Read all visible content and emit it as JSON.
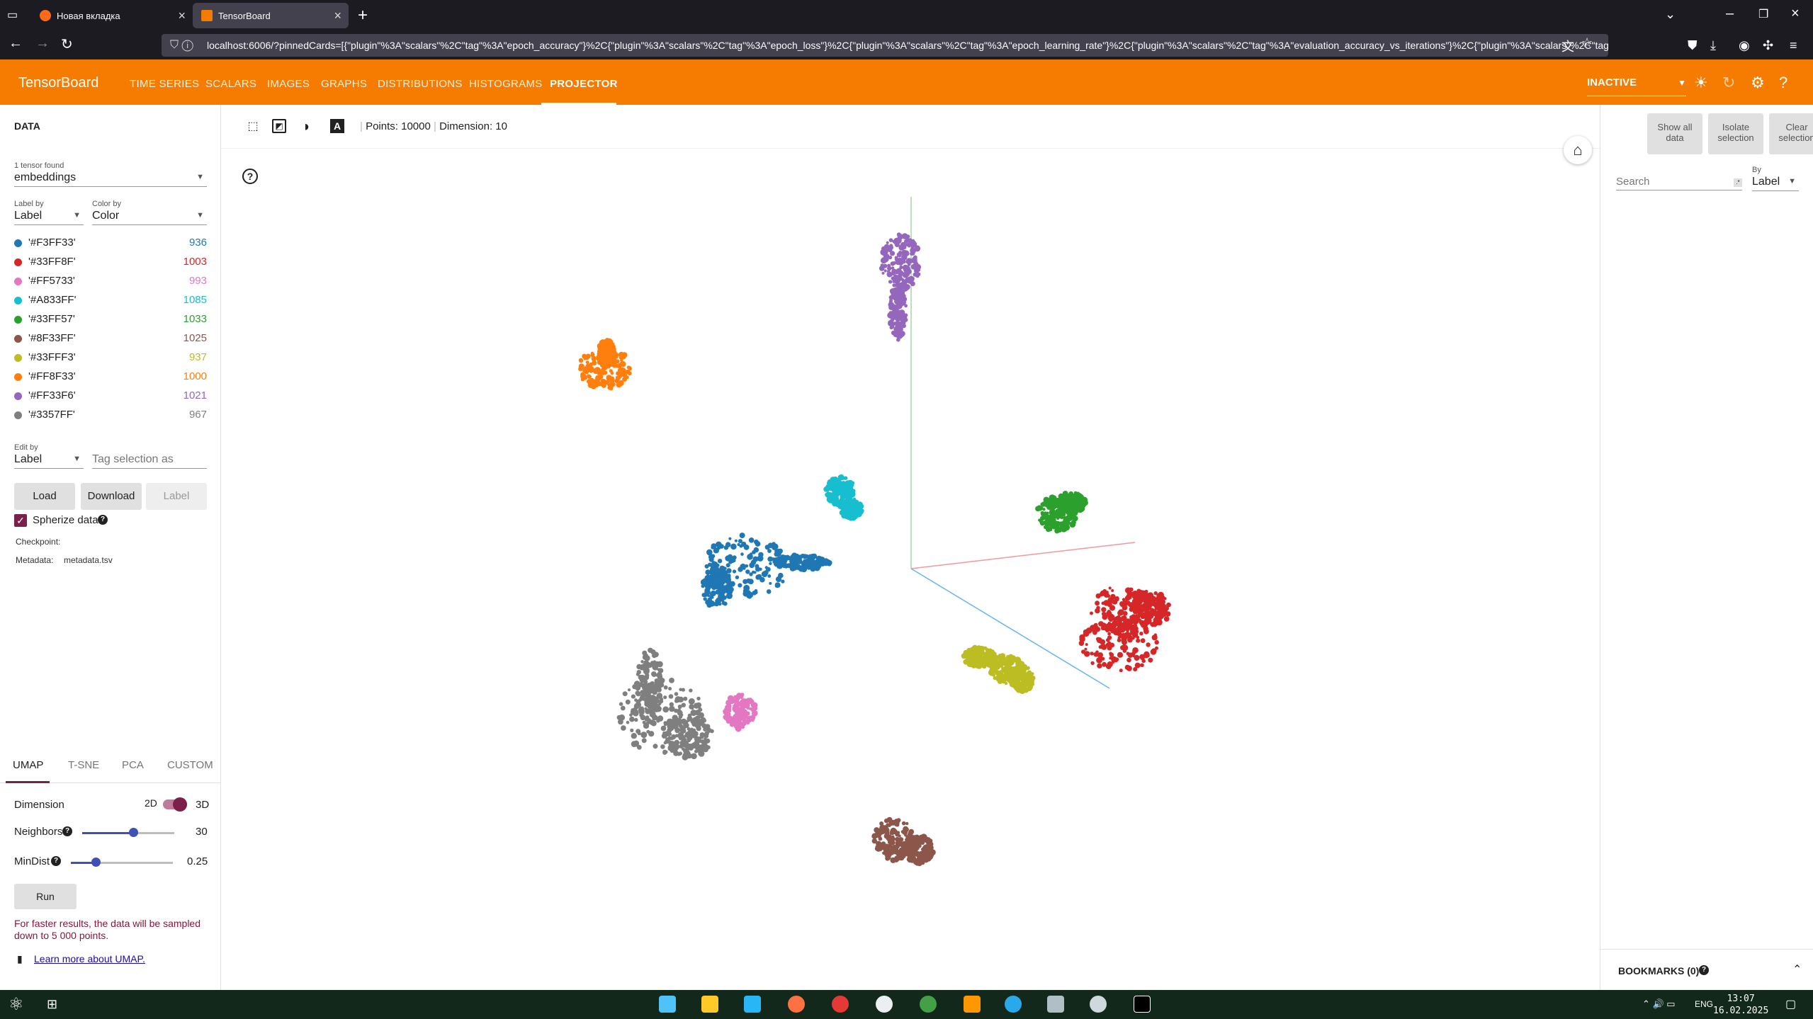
{
  "browser": {
    "tabs": [
      {
        "title": "Новая вкладка"
      },
      {
        "title": "TensorBoard"
      }
    ],
    "url": "localhost:6006/?pinnedCards=[{\"plugin\"%3A\"scalars\"%2C\"tag\"%3A\"epoch_accuracy\"}%2C{\"plugin\"%3A\"scalars\"%2C\"tag\"%3A\"epoch_loss\"}%2C{\"plugin\"%3A\"scalars\"%2C\"tag\"%3A\"epoch_learning_rate\"}%2C{\"plugin\"%3A\"scalars\"%2C\"tag\"%3A\"evaluation_accuracy_vs_iterations\"}%2C{\"plugin\"%3A\"scalars\"%2C\"tag\"%3A\"tag"
  },
  "header": {
    "logo": "TensorBoard",
    "nav": [
      "TIME SERIES",
      "SCALARS",
      "IMAGES",
      "GRAPHS",
      "DISTRIBUTIONS",
      "HISTOGRAMS",
      "PROJECTOR"
    ],
    "active_nav": "PROJECTOR",
    "status": "INACTIVE",
    "accent": "#f57c00"
  },
  "left": {
    "title": "DATA",
    "tensor_found": "1 tensor found",
    "tensor": "embeddings",
    "label_by_caption": "Label by",
    "label_by": "Label",
    "color_by_caption": "Color by",
    "color_by": "Color",
    "labels": [
      {
        "name": "'#F3FF33'",
        "count": "936",
        "color": "#1f77b4"
      },
      {
        "name": "'#33FF8F'",
        "count": "1003",
        "color": "#d62728"
      },
      {
        "name": "'#FF5733'",
        "count": "993",
        "color": "#e377c2"
      },
      {
        "name": "'#A833FF'",
        "count": "1085",
        "color": "#17becf"
      },
      {
        "name": "'#33FF57'",
        "count": "1033",
        "color": "#2ca02c"
      },
      {
        "name": "'#8F33FF'",
        "count": "1025",
        "color": "#8c564b"
      },
      {
        "name": "'#33FFF3'",
        "count": "937",
        "color": "#bcbd22"
      },
      {
        "name": "'#FF8F33'",
        "count": "1000",
        "color": "#ff7f0e"
      },
      {
        "name": "'#FF33F6'",
        "count": "1021",
        "color": "#9467bd"
      },
      {
        "name": "'#3357FF'",
        "count": "967",
        "color": "#7f7f7f"
      }
    ],
    "edit_by_caption": "Edit by",
    "edit_by": "Label",
    "tag_placeholder": "Tag selection as",
    "buttons": {
      "load": "Load",
      "download": "Download",
      "label": "Label"
    },
    "sphereize": "Spherize data",
    "checkpoint": "Checkpoint:",
    "metadata_label": "Metadata:",
    "metadata_value": "metadata.tsv",
    "methods": [
      "UMAP",
      "T-SNE",
      "PCA",
      "CUSTOM"
    ],
    "dimension_label": "Dimension",
    "dim_2d": "2D",
    "dim_3d": "3D",
    "neighbors_label": "Neighbors",
    "neighbors_value": "30",
    "mindist_label": "MinDist",
    "mindist_value": "0.25",
    "run": "Run",
    "note": "For faster results, the data will be sampled down to 5 000 points.",
    "learn_more": "Learn more about UMAP."
  },
  "toolbar": {
    "points_label": "Points: 10000",
    "dimension_label": "Dimension: 10"
  },
  "right": {
    "show_all": "Show all data",
    "isolate": "Isolate selection",
    "clear": "Clear selection",
    "search_placeholder": "Search",
    "by_caption": "By",
    "by_value": "Label",
    "bookmarks": "BOOKMARKS (0)"
  },
  "taskbar": {
    "lang": "ENG",
    "time": "13:07",
    "date": "16.02.2025"
  }
}
